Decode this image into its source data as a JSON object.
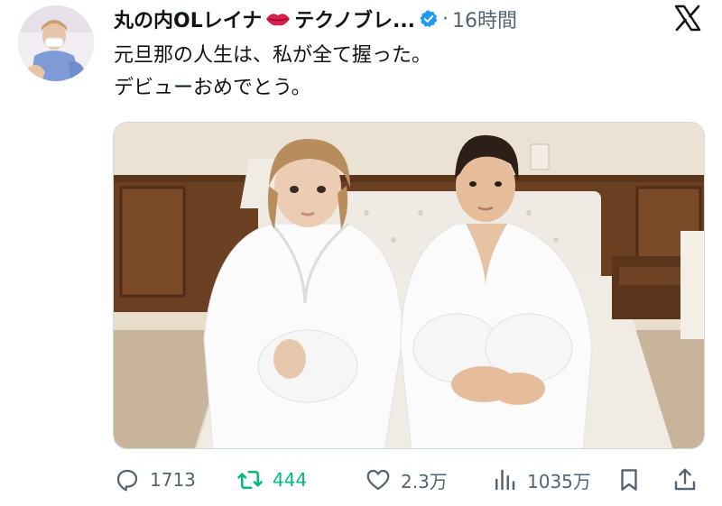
{
  "author": {
    "display_name": "丸の内OLレイナ",
    "display_name_tail": "テクノブレ...",
    "emoji_icon": "lips-icon",
    "verified_icon": "verified-icon",
    "verified_color": "#1d9bf0",
    "separator": "·",
    "timestamp": "16時間"
  },
  "tweet": {
    "line1": "元旦那の人生は、私が全て握った。",
    "line2": "デビューおめでとう。"
  },
  "actions": {
    "replies": "1713",
    "retweets": "444",
    "likes": "2.3万",
    "views": "1035万"
  },
  "colors": {
    "text": "#0f1419",
    "secondary": "#536471",
    "retweet_green": "#00ba7c"
  }
}
